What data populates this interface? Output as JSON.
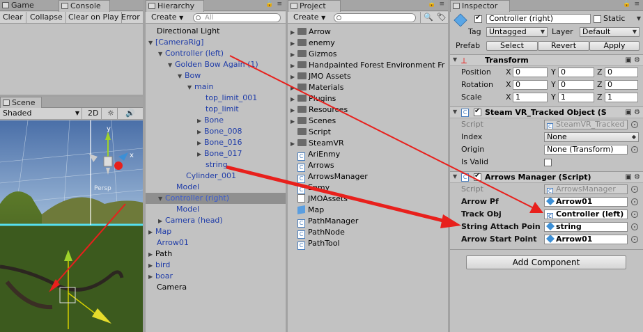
{
  "console": {
    "tabs": {
      "game": "Game",
      "console": "Console"
    },
    "toolbar": {
      "clear": "Clear",
      "collapse": "Collapse",
      "clear_on_play": "Clear on Play",
      "error_pause": "Error P"
    }
  },
  "scene": {
    "tab": "Scene",
    "shading": "Shaded",
    "mode_2d": "2D",
    "persp_label": "Persp",
    "gizmo_axis_y": "y",
    "gizmo_axis_x": "x"
  },
  "hierarchy": {
    "tab": "Hierarchy",
    "create": "Create",
    "search_placeholder": "All",
    "items": [
      {
        "label": "Directional Light"
      },
      {
        "label": "[CameraRig]"
      },
      {
        "label": "Controller (left)"
      },
      {
        "label": "Golden Bow Again (1)"
      },
      {
        "label": "Bow"
      },
      {
        "label": "main"
      },
      {
        "label": "top_limit_001"
      },
      {
        "label": "top_limit"
      },
      {
        "label": "Bone"
      },
      {
        "label": "Bone_008"
      },
      {
        "label": "Bone_016"
      },
      {
        "label": "Bone_017"
      },
      {
        "label": "string"
      },
      {
        "label": "Cylinder_001"
      },
      {
        "label": "Model"
      },
      {
        "label": "Controller (right)"
      },
      {
        "label": "Model"
      },
      {
        "label": "Camera (head)"
      },
      {
        "label": "Map"
      },
      {
        "label": "Arrow01"
      },
      {
        "label": "Path"
      },
      {
        "label": "bird"
      },
      {
        "label": "boar"
      },
      {
        "label": "Camera"
      }
    ]
  },
  "project": {
    "tab": "Project",
    "create": "Create",
    "items": [
      {
        "label": "Arrow"
      },
      {
        "label": "enemy"
      },
      {
        "label": "Gizmos"
      },
      {
        "label": "Handpainted Forest Environment Fr"
      },
      {
        "label": "JMO Assets"
      },
      {
        "label": "Materials"
      },
      {
        "label": "Plugins"
      },
      {
        "label": "Resources"
      },
      {
        "label": "Scenes"
      },
      {
        "label": "Script"
      },
      {
        "label": "SteamVR"
      },
      {
        "label": "AriEnmy"
      },
      {
        "label": "Arrows"
      },
      {
        "label": "ArrowsManager"
      },
      {
        "label": "Enmy"
      },
      {
        "label": "JMOAssets"
      },
      {
        "label": "Map"
      },
      {
        "label": "PathManager"
      },
      {
        "label": "PathNode"
      },
      {
        "label": "PathTool"
      }
    ]
  },
  "inspector": {
    "tab": "Inspector",
    "object_name": "Controller (right)",
    "static_label": "Static",
    "tag_label": "Tag",
    "tag_value": "Untagged",
    "layer_label": "Layer",
    "layer_value": "Default",
    "prefab_label": "Prefab",
    "prefab_select": "Select",
    "prefab_revert": "Revert",
    "prefab_apply": "Apply",
    "transform": {
      "title": "Transform",
      "position_label": "Position",
      "rotation_label": "Rotation",
      "scale_label": "Scale",
      "x": "X",
      "y": "Y",
      "z": "Z",
      "position": [
        "0",
        "0",
        "0"
      ],
      "rotation": [
        "0",
        "0",
        "0"
      ],
      "scale": [
        "1",
        "1",
        "1"
      ]
    },
    "steamvr": {
      "title": "Steam VR_Tracked Object (S",
      "script_label": "Script",
      "script_value": "SteamVR_Tracked",
      "index_label": "Index",
      "index_value": "None",
      "origin_label": "Origin",
      "origin_value": "None (Transform)",
      "is_valid_label": "Is Valid"
    },
    "arrows_manager": {
      "title": "Arrows Manager (Script)",
      "script_label": "Script",
      "script_value": "ArrowsManager",
      "arrow_pf_label": "Arrow Pf",
      "arrow_pf_value": "Arrow01",
      "track_obj_label": "Track Obj",
      "track_obj_value": "Controller (left)",
      "string_attach_label": "String Attach Poin",
      "string_attach_value": "string",
      "arrow_start_label": "Arrow Start Point",
      "arrow_start_value": "Arrow01"
    },
    "add_component": "Add Component"
  },
  "colors": {
    "annotation_arrow": "#e8201c",
    "selection": "#8f8f8f",
    "link_blue": "#1f3ca8"
  }
}
